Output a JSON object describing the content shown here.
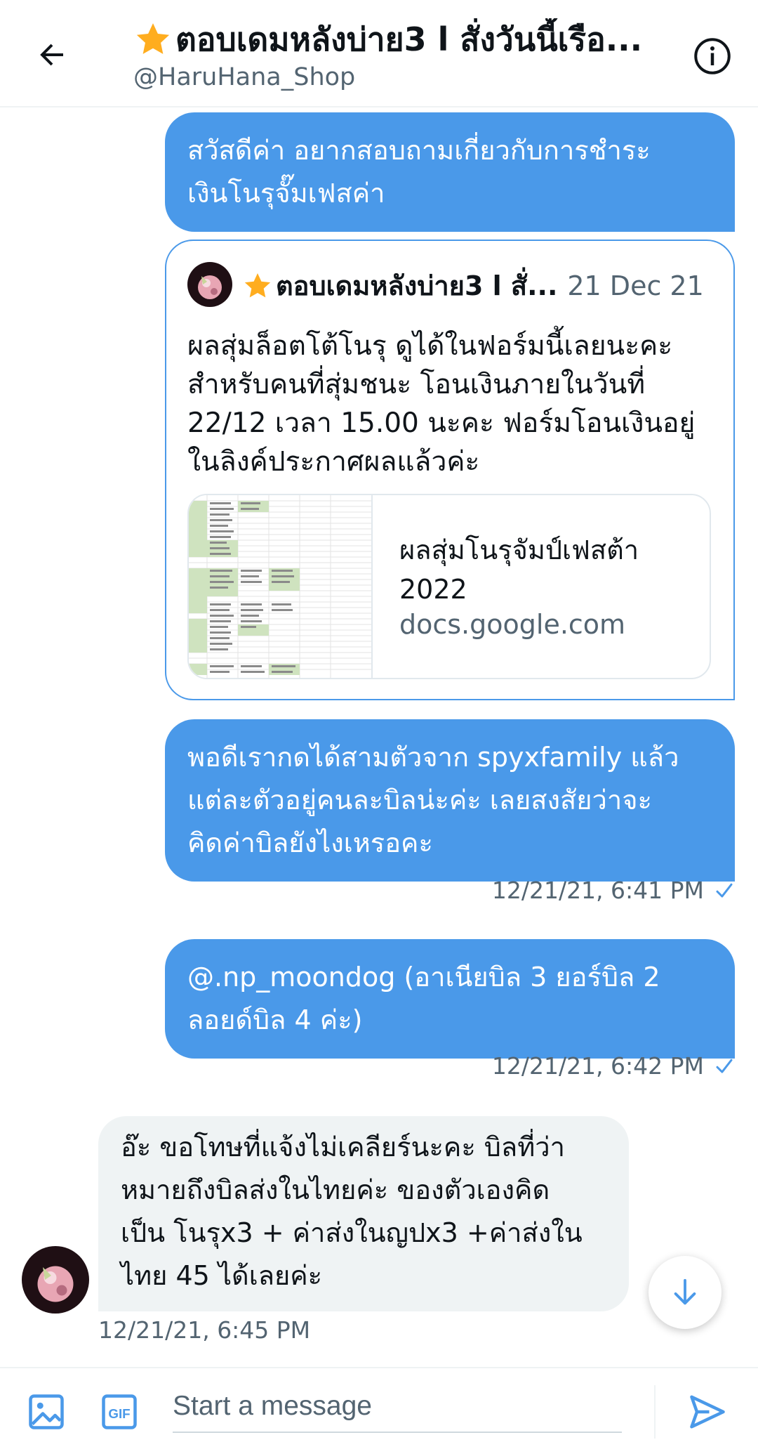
{
  "header": {
    "title": "ตอบเดมหลังบ่าย3 l สั่งวันนี้เรือ...",
    "handle": "@HaruHana_Shop",
    "back_icon": "arrow-left-icon",
    "info_icon": "info-icon",
    "star_icon": "star-icon"
  },
  "messages": [
    {
      "text": "สวัสดีค่า อยากสอบถามเกี่ยวกับการชำระ\nเงินโนรุจั๊มเฟสค่า"
    },
    {
      "text": "พอดีเรากดได้สามตัวจาก spyxfamily  แล้ว\nแต่ละตัวอยู่คนละบิลน่ะค่ะ เลยสงสัยว่าจะ\nคิดค่าบิลยังไงเหรอคะ",
      "time": "12/21/21, 6:41 PM"
    },
    {
      "text": "@.np_moondog (อาเนียบิล 3 ยอร์บิล 2\nลอยด์บิล 4 ค่ะ)",
      "time": "12/21/21, 6:42 PM"
    }
  ],
  "quote": {
    "name": "ตอบเดมหลังบ่าย3 l สั่...",
    "date": "21 Dec 21",
    "text": "ผลสุ่มล็อตโต้โนรุ ดูได้ในฟอร์มนี้เลยนะคะ\nสำหรับคนที่สุ่มชนะ โอนเงินภายในวันที่\n22/12 เวลา 15.00 นะคะ ฟอร์มโอนเงินอยู่\nในลิงค์ประกาศผลแล้วค่ะ",
    "link_title": "ผลสุ่มโนรุจัมป์เฟสต้า\n2022",
    "link_domain": "docs.google.com"
  },
  "incoming": {
    "text": "อ๊ะ ขอโทษที่แจ้งไม่เคลียร์นะคะ บิลที่ว่า\nหมายถึงบิลส่งในไทยค่ะ ของตัวเองคิด\nเป็น โนรุx3 + ค่าส่งในญปx3 +ค่าส่งใน\nไทย 45 ได้เลยค่ะ",
    "time": "12/21/21, 6:45 PM"
  },
  "composer": {
    "placeholder": "Start a message",
    "media_icon": "image-icon",
    "gif_label": "GIF",
    "send_icon": "send-icon"
  },
  "colors": {
    "accent": "#4a99e9",
    "incoming_bg": "#eff3f4",
    "muted": "#536471",
    "star": "#ffad1f"
  }
}
